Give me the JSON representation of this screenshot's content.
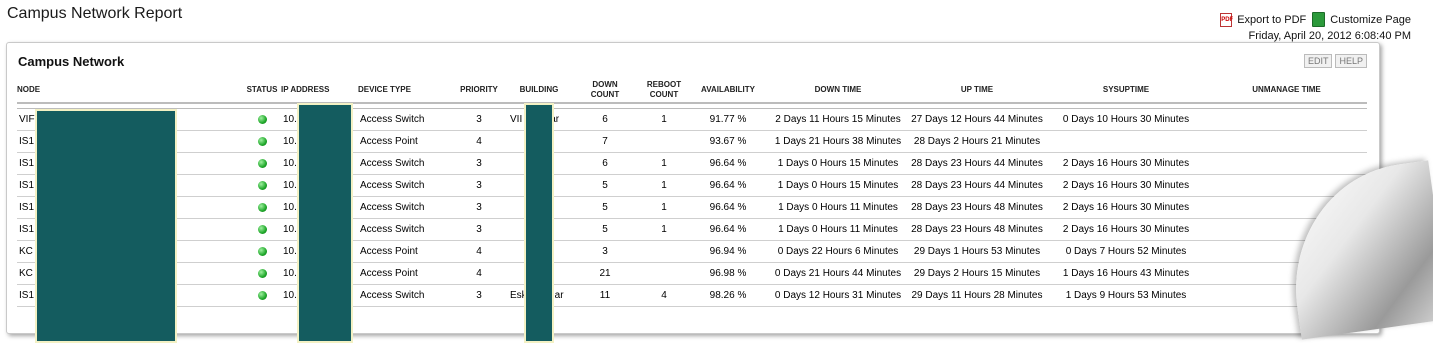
{
  "page": {
    "title": "Campus Network Report",
    "export_pdf": "Export to PDF",
    "customize": "Customize Page",
    "timestamp": "Friday, April 20, 2012 6:08:40 PM"
  },
  "panel": {
    "title": "Campus Network",
    "edit": "EDIT",
    "help": "HELP"
  },
  "columns": {
    "node": "NODE",
    "status": "STATUS",
    "ip": "IP ADDRESS",
    "device_type": "DEVICE TYPE",
    "priority": "PRIORITY",
    "building": "BUILDING",
    "down_count_1": "DOWN",
    "down_count_2": "COUNT",
    "reboot_count_1": "REBOOT",
    "reboot_count_2": "COUNT",
    "availability": "AVAILABILITY",
    "down_time": "DOWN TIME",
    "up_time": "UP TIME",
    "sysuptime": "SYSUPTIME",
    "unmanage_time": "UNMANAGE TIME"
  },
  "rows": [
    {
      "node": "VIF",
      "status": "up",
      "ip": "10.",
      "device": "Access Switch",
      "priority": "3",
      "building": "VII",
      "building_tail": "ar",
      "down_count": "6",
      "reboot_count": "1",
      "availability": "91.77 %",
      "down_time": "2 Days 11 Hours 15 Minutes",
      "up_time": "27 Days 12 Hours 44 Minutes",
      "sysuptime": "0 Days 10 Hours 30 Minutes",
      "unmanage": ""
    },
    {
      "node": "IS1",
      "status": "up",
      "ip": "10.",
      "device": "Access Point",
      "priority": "4",
      "building": "",
      "building_tail": "",
      "down_count": "7",
      "reboot_count": "",
      "availability": "93.67 %",
      "down_time": "1 Days 21 Hours 38 Minutes",
      "up_time": "28 Days 2 Hours 21 Minutes",
      "sysuptime": "",
      "unmanage": ""
    },
    {
      "node": "IS1",
      "status": "up",
      "ip": "10.",
      "device": "Access Switch",
      "priority": "3",
      "building": "",
      "building_tail": "",
      "down_count": "6",
      "reboot_count": "1",
      "availability": "96.64 %",
      "down_time": "1 Days 0 Hours 15 Minutes",
      "up_time": "28 Days 23 Hours 44 Minutes",
      "sysuptime": "2 Days 16 Hours 30 Minutes",
      "unmanage": ""
    },
    {
      "node": "IS1",
      "status": "up",
      "ip": "10.",
      "device": "Access Switch",
      "priority": "3",
      "building": "",
      "building_tail": "",
      "down_count": "5",
      "reboot_count": "1",
      "availability": "96.64 %",
      "down_time": "1 Days 0 Hours 15 Minutes",
      "up_time": "28 Days 23 Hours 44 Minutes",
      "sysuptime": "2 Days 16 Hours 30 Minutes",
      "unmanage": ""
    },
    {
      "node": "IS1",
      "status": "up",
      "ip": "10.",
      "device": "Access Switch",
      "priority": "3",
      "building": "",
      "building_tail": "",
      "down_count": "5",
      "reboot_count": "1",
      "availability": "96.64 %",
      "down_time": "1 Days 0 Hours 11 Minutes",
      "up_time": "28 Days 23 Hours 48 Minutes",
      "sysuptime": "2 Days 16 Hours 30 Minutes",
      "unmanage": ""
    },
    {
      "node": "IS1",
      "status": "up",
      "ip": "10.",
      "device": "Access Switch",
      "priority": "3",
      "building": "",
      "building_tail": "",
      "down_count": "5",
      "reboot_count": "1",
      "availability": "96.64 %",
      "down_time": "1 Days 0 Hours 11 Minutes",
      "up_time": "28 Days 23 Hours 48 Minutes",
      "sysuptime": "2 Days 16 Hours 30 Minutes",
      "unmanage": ""
    },
    {
      "node": "KC",
      "status": "up",
      "ip": "10.",
      "device": "Access Point",
      "priority": "4",
      "building": "",
      "building_tail": "",
      "down_count": "3",
      "reboot_count": "",
      "availability": "96.94 %",
      "down_time": "0 Days 22 Hours 6 Minutes",
      "up_time": "29 Days 1 Hours 53 Minutes",
      "sysuptime": "0 Days 7 Hours 52 Minutes",
      "unmanage": ""
    },
    {
      "node": "KC",
      "status": "up",
      "ip": "10.",
      "device": "Access Point",
      "priority": "4",
      "building": "",
      "building_tail": "",
      "down_count": "21",
      "reboot_count": "",
      "availability": "96.98 %",
      "down_time": "0 Days 21 Hours 44 Minutes",
      "up_time": "29 Days 2 Hours 15 Minutes",
      "sysuptime": "1 Days 16 Hours 43 Minutes",
      "unmanage": ""
    },
    {
      "node": "IS1",
      "status": "up",
      "ip": "10.",
      "device": "Access Switch",
      "priority": "3",
      "building": "Esk",
      "building_tail": "ar",
      "down_count": "11",
      "reboot_count": "4",
      "availability": "98.26 %",
      "down_time": "0 Days 12 Hours 31 Minutes",
      "up_time": "29 Days 11 Hours 28 Minutes",
      "sysuptime": "1 Days 9 Hours 53 Minutes",
      "unmanage": ""
    }
  ],
  "colors": {
    "status_up": "#1fa82a",
    "redaction": "#145c5f",
    "redaction_border": "#f3f1c4"
  }
}
